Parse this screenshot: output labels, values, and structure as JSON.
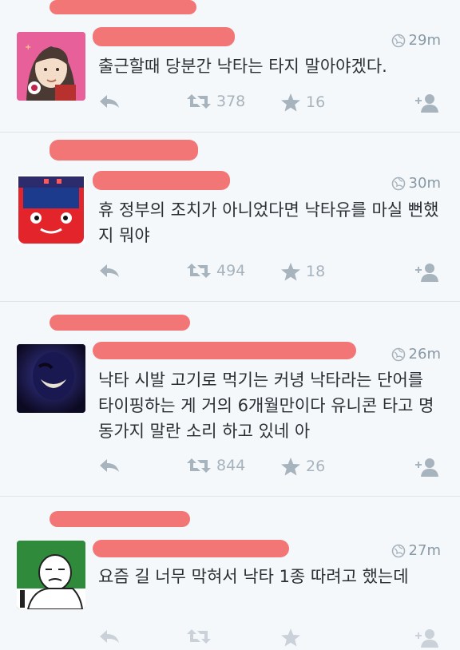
{
  "tweets": [
    {
      "time": "29m",
      "text": "출근할때 당분간 낙타는 타지 말아야겠다.",
      "retweets": "378",
      "favorites": "16"
    },
    {
      "time": "30m",
      "text": "휴 정부의 조치가 아니었다면 낙타유를 마실 뻔했지 뭐야",
      "retweets": "494",
      "favorites": "18"
    },
    {
      "time": "26m",
      "text": "낙타 시발 고기로 먹기는 커녕 낙타라는 단어를 타이핑하는 게 거의 6개월만이다 유니콘 타고 명동가지 말란 소리 하고 있네 아",
      "retweets": "844",
      "favorites": "26"
    },
    {
      "time": "27m",
      "text": "요즘 길 너무 막혀서 낙타 1종 따려고 했는데"
    }
  ],
  "colors": {
    "background": "#f5f8fa",
    "redaction": "#f26a6a",
    "meta": "#8899a6",
    "action": "#a7b3bd"
  },
  "icons": [
    "reply-icon",
    "retweet-icon",
    "favorite-icon",
    "follow-icon",
    "globe-icon"
  ]
}
